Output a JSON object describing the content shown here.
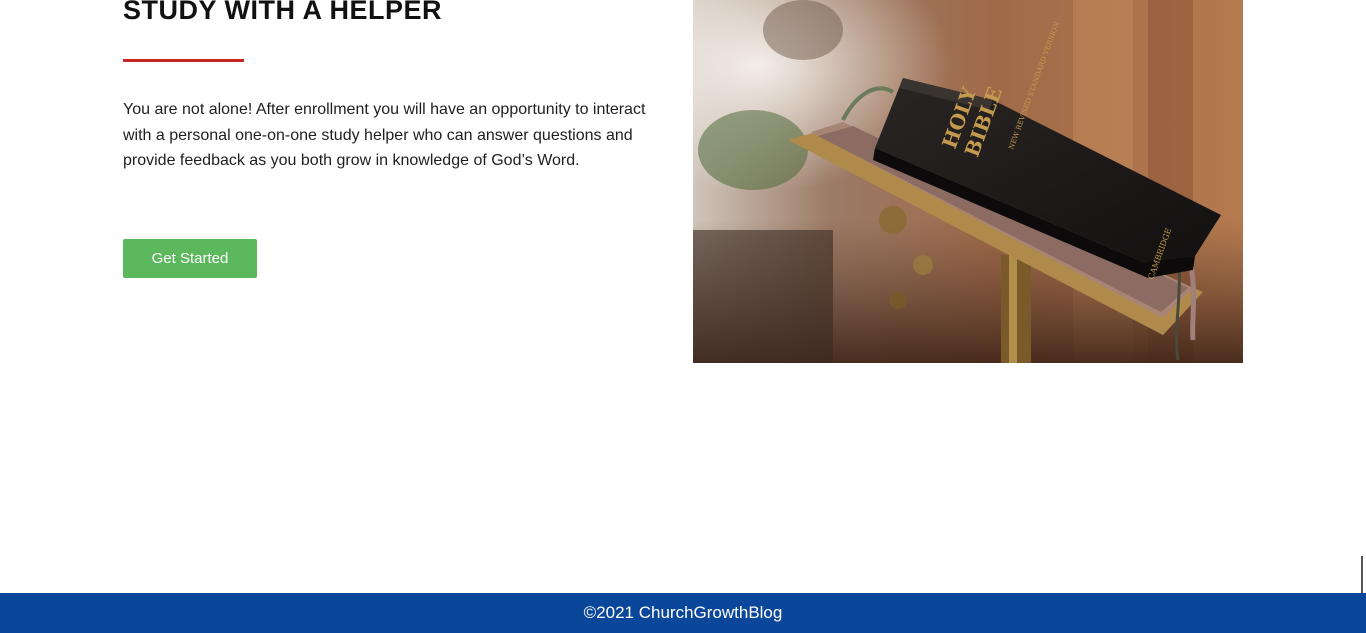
{
  "section": {
    "heading": "STUDY WITH A HELPER",
    "body": "You are not alone! After enrollment you will have an opportunity to interact with  a personal one-on-one study helper who can answer questions and provide feedback as you both grow in knowledge of God’s Word.",
    "cta_label": "Get Started"
  },
  "image": {
    "spine_title_1": "HOLY",
    "spine_title_2": "BIBLE",
    "spine_subtitle": "NEW REVISED STANDARD VERSION",
    "spine_publisher": "CAMBRIDGE"
  },
  "footer": {
    "copyright": "©2021 ChurchGrowthBlog"
  },
  "colors": {
    "accent_red": "#c62828",
    "cta_green": "#5cb85c",
    "footer_blue": "#0a4699"
  }
}
